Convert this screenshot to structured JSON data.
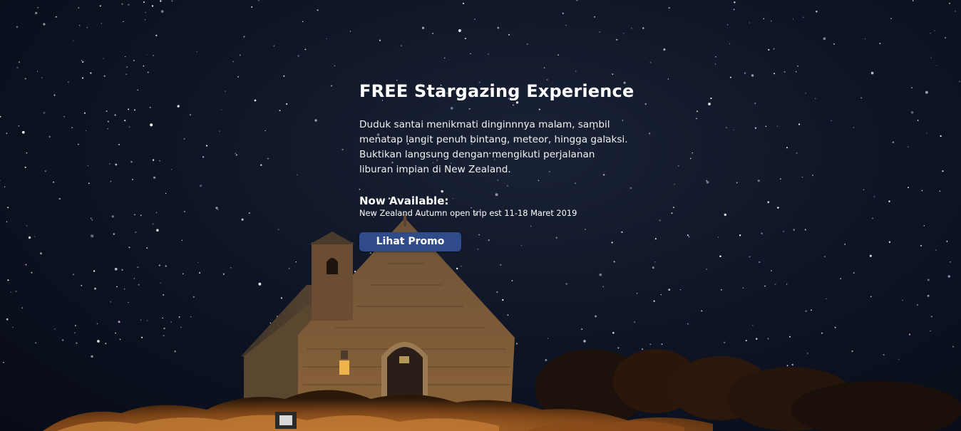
{
  "hero": {
    "title": "FREE Stargazing Experience",
    "description": "Duduk santai menikmati dinginnnya malam, sambil menatap langit penuh bintang, meteor, hingga galaksi. Buktikan langsung dengan mengikuti perjalanan liburan impian di New Zealand.",
    "availability_label": "Now Available:",
    "availability_text": "New Zealand Autumn open trip est 11-18 Maret 2019",
    "cta_label": "Lihat Promo",
    "colors": {
      "sky": "#0e1526",
      "button": "#2f4b8a",
      "text": "#ffffff",
      "chapel_stone": "#7a5a3c",
      "grass": "#9a5a22"
    }
  }
}
